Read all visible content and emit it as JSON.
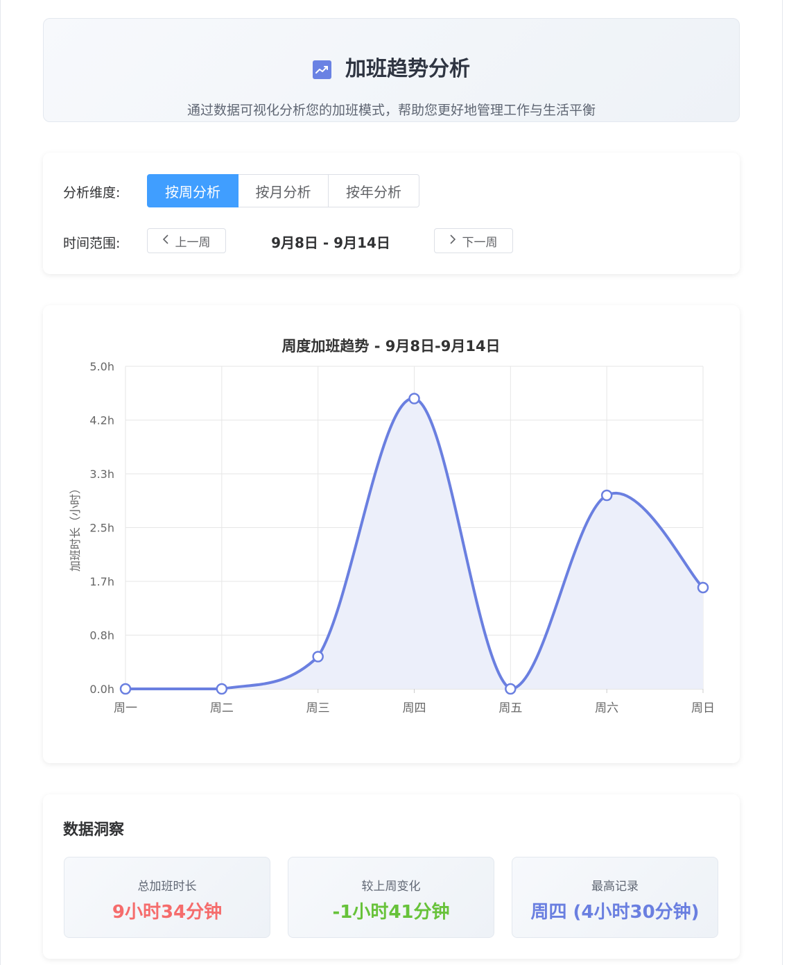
{
  "header": {
    "icon": "trending-chart-icon",
    "title": "加班趋势分析",
    "subtitle": "通过数据可视化分析您的加班模式，帮助您更好地管理工作与生活平衡"
  },
  "controls": {
    "dimension_label": "分析维度:",
    "dimension_options": [
      "按周分析",
      "按月分析",
      "按年分析"
    ],
    "dimension_selected": "按周分析",
    "range_label": "时间范围:",
    "prev_button": "上一周",
    "next_button": "下一周",
    "range_text": "9月8日 - 9月14日"
  },
  "colors": {
    "accent": "#409eff",
    "line": "#6a7fe0",
    "fill": "#eceffa",
    "total": "#f56c6c",
    "change": "#67c23a",
    "record": "#6a7fe0"
  },
  "chart_data": {
    "type": "area",
    "title": "周度加班趋势 - 9月8日-9月14日",
    "ylabel": "加班时长（小时）",
    "categories": [
      "周一",
      "周二",
      "周三",
      "周四",
      "周五",
      "周六",
      "周日"
    ],
    "values": [
      0,
      0,
      0.5,
      4.5,
      0,
      3.0,
      1.57
    ],
    "ylim": [
      0,
      5.0
    ],
    "yticks": [
      "0.0h",
      "0.8h",
      "1.7h",
      "2.5h",
      "3.3h",
      "4.2h",
      "5.0h"
    ],
    "smooth": true,
    "grid": true
  },
  "insights": {
    "title": "数据洞察",
    "cards": [
      {
        "label": "总加班时长",
        "value": "9小时34分钟"
      },
      {
        "label": "较上周变化",
        "value": "-1小时41分钟"
      },
      {
        "label": "最高记录",
        "value": "周四 (4小时30分钟)"
      }
    ]
  }
}
